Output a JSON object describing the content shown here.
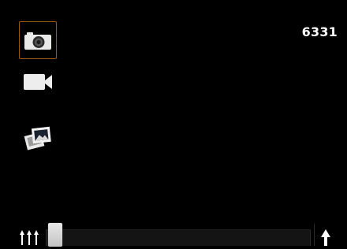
{
  "status": {
    "remaining_shots": "6331"
  },
  "modes": {
    "items": [
      {
        "id": "camera",
        "icon": "camera-icon",
        "selected": true
      },
      {
        "id": "video",
        "icon": "video-camera-icon",
        "selected": false
      },
      {
        "id": "gallery",
        "icon": "gallery-icon",
        "selected": false
      }
    ],
    "selected_border_color": "#9a5a12"
  },
  "burst_control": {
    "left_icon": "multiple-shots-icon",
    "right_icon": "single-shot-icon",
    "slider_level": 0.0
  }
}
